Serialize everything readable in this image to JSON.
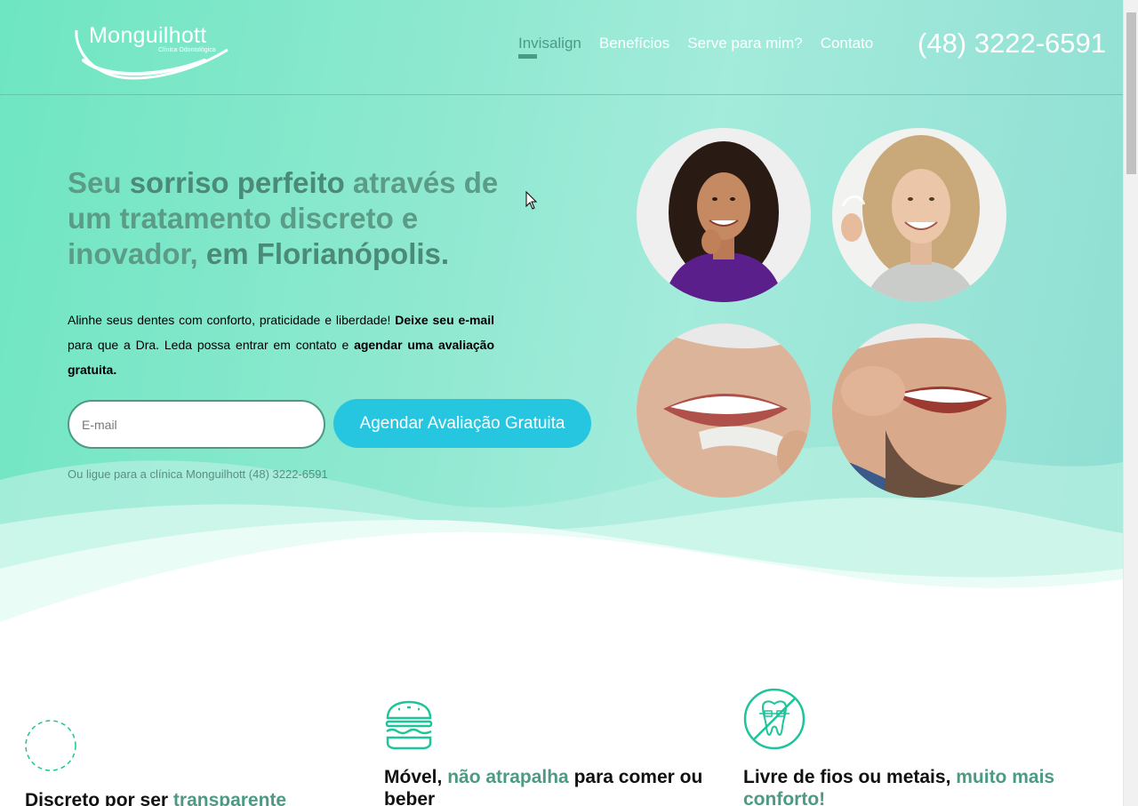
{
  "brand": {
    "name": "Monguilhott",
    "subtitle": "Clínica Odontológica"
  },
  "nav": {
    "items": [
      {
        "label": "Invisalign",
        "active": true
      },
      {
        "label": "Benefícios",
        "active": false
      },
      {
        "label": "Serve para mim?",
        "active": false
      },
      {
        "label": "Contato",
        "active": false
      }
    ],
    "phone": "(48) 3222-6591"
  },
  "hero": {
    "headline": {
      "p1": "Seu ",
      "b1": "sorriso perfeito",
      "p2": " através de um tratamento discreto e inovador, ",
      "b2": "em Florianópolis."
    },
    "lead": {
      "p1": "Alinhe seus dentes com conforto, praticidade e liberdade! ",
      "b1": "Deixe seu e-mail",
      "p2": " para que a Dra. Leda possa entrar em contato e ",
      "b2": "agendar uma avaliação gratuita."
    },
    "email_placeholder": "E-mail",
    "cta_label": "Agendar Avaliação Gratuita",
    "call_line": "Ou ligue para a clínica Monguilhott (48) 3222-6591"
  },
  "features": [
    {
      "title": "Discreto por ser ",
      "accent": "transparente",
      "tail": "",
      "icon": "transparent-circle-icon"
    },
    {
      "title": "Móvel, ",
      "accent": "não atrapalha",
      "tail": " para comer ou beber",
      "icon": "burger-icon"
    },
    {
      "title": "Livre de fios ou metais, ",
      "accent": "muito mais conforto!",
      "tail": "",
      "icon": "no-braces-tooth-icon"
    }
  ],
  "colors": {
    "accent": "#4d9a84",
    "cta": "#26c6e0",
    "hero_start": "#6ee6c1",
    "hero_end": "#8fded3",
    "icon": "#1fc49a"
  }
}
